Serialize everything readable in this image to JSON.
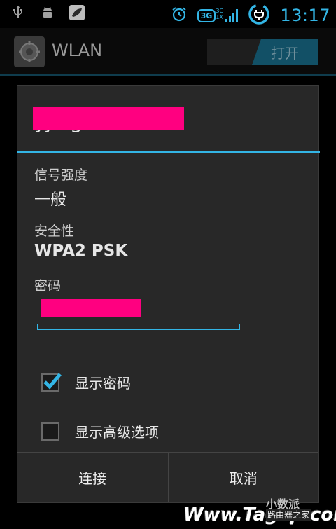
{
  "status_bar": {
    "time": "13:17",
    "network_type": "3G",
    "network_small_top": "3G",
    "network_small_bottom": "1X",
    "icons_left": [
      "usb-icon",
      "android-debug-icon",
      "app-notification-icon"
    ],
    "icons_right": [
      "alarm-icon",
      "3g-icon",
      "signal-icon",
      "battery-charging-icon"
    ]
  },
  "app_bar": {
    "title": "WLAN",
    "toggle_label": "打开",
    "icon": "settings-gear-icon"
  },
  "dialog": {
    "title_redacted": true,
    "signal": {
      "label": "信号强度",
      "value": "一般"
    },
    "security": {
      "label": "安全性",
      "value": "WPA2 PSK"
    },
    "password": {
      "label": "密码",
      "value": ""
    },
    "show_password": {
      "label": "显示密码",
      "checked": true
    },
    "show_advanced": {
      "label": "显示高级选项",
      "checked": false
    },
    "buttons": {
      "connect": "连接",
      "cancel": "取消"
    }
  },
  "watermark": {
    "url": "Www.Tagxp.com",
    "brand": "小数派",
    "sub": "路由器之家"
  },
  "colors": {
    "accent": "#33b5e5",
    "redaction": "#ff0080",
    "dialog_bg": "#282828"
  }
}
